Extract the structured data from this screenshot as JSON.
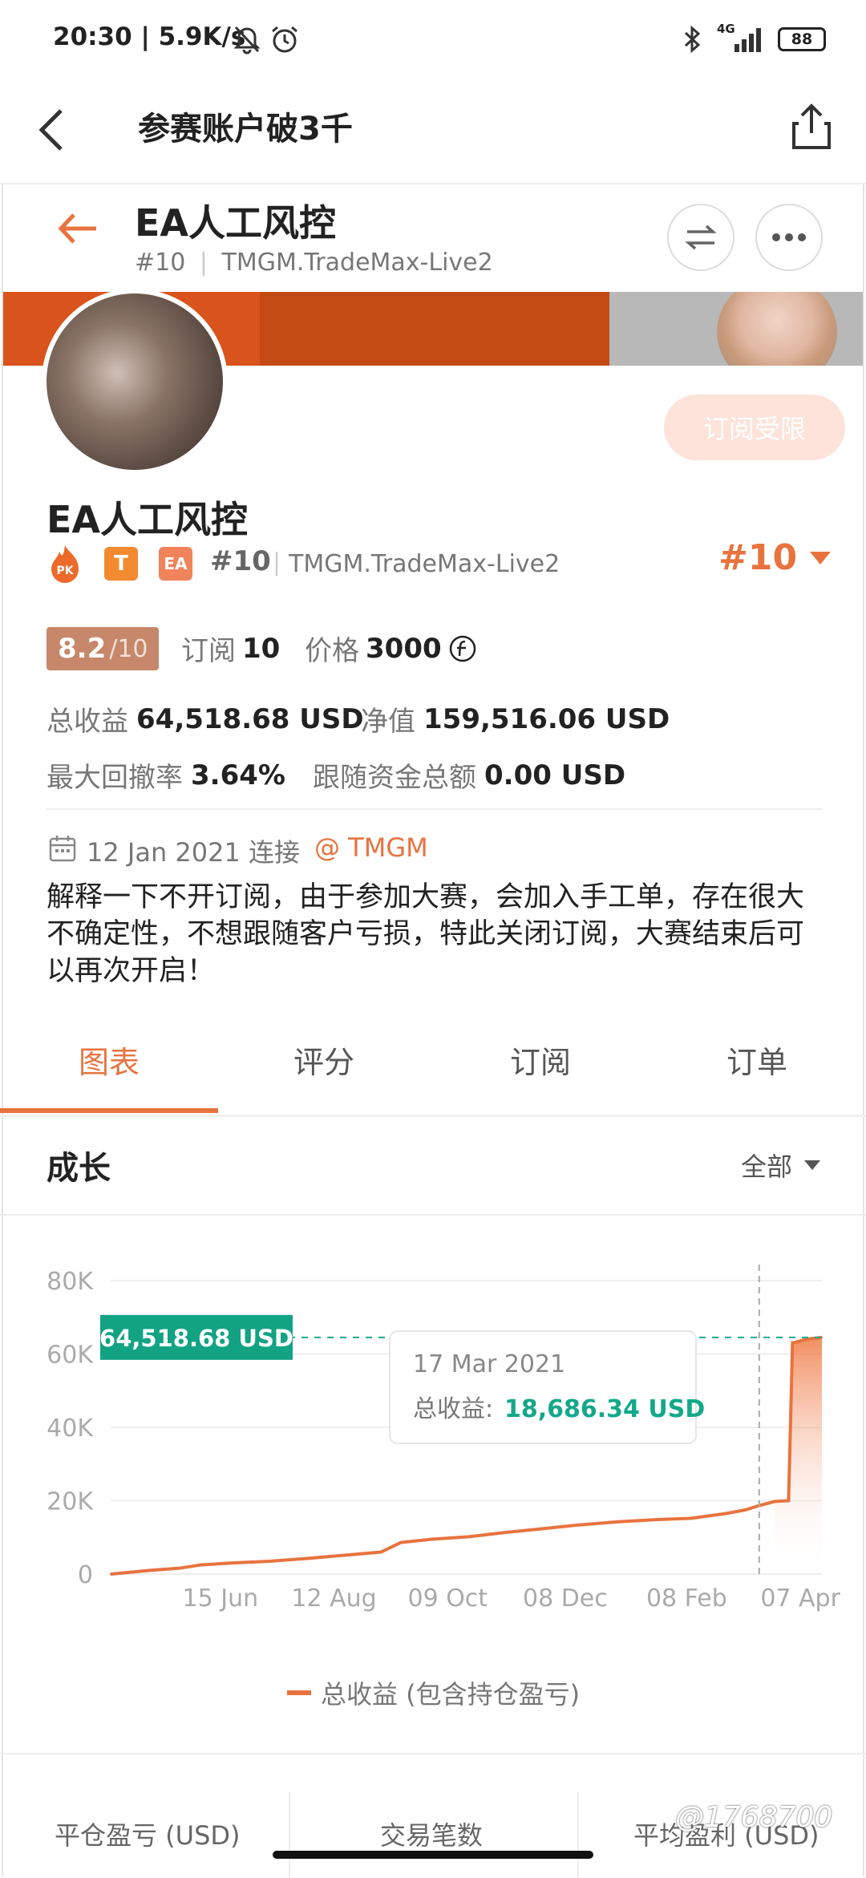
{
  "status_bar": {
    "time": "20:30 | 5.9K/s",
    "battery": "88",
    "network": "4G"
  },
  "navbar": {
    "title": "参赛账户破3千"
  },
  "profile_header": {
    "name": "EA人工风控",
    "rank": "#10",
    "server": "TMGM.TradeMax-Live2"
  },
  "profile": {
    "subscribe_button": "订阅受限",
    "name": "EA人工风控",
    "badges": [
      "T",
      "EA"
    ],
    "rank": "#10",
    "server": "TMGM.TradeMax-Live2",
    "rank_big": "#10",
    "score": "8.2",
    "score_max": "/10",
    "subscriptions_label": "订阅",
    "subscriptions": "10",
    "price_label": "价格",
    "price": "3000",
    "total_profit_label": "总收益",
    "total_profit": "64,518.68 USD",
    "net_value_label": "净值",
    "net_value": "159,516.06 USD",
    "max_drawdown_label": "最大回撤率",
    "max_drawdown": "3.64%",
    "follow_funds_label": "跟随资金总额",
    "follow_funds": "0.00 USD",
    "connected_date": "12 Jan 2021 连接",
    "broker_link": "@ TMGM",
    "description": "解释一下不开订阅，由于参加大赛，会加入手工单，存在很大不确定性，不想跟随客户亏损，特此关闭订阅，大赛结束后可以再次开启！"
  },
  "tabs": [
    {
      "label": "图表",
      "active": true
    },
    {
      "label": "评分",
      "active": false
    },
    {
      "label": "订阅",
      "active": false
    },
    {
      "label": "订单",
      "active": false
    }
  ],
  "growth": {
    "title": "成长",
    "filter": "全部"
  },
  "chart_data": {
    "type": "area",
    "ylim": [
      0,
      80000
    ],
    "yticks": [
      "80K",
      "60K",
      "40K",
      "20K",
      "0"
    ],
    "xticks": [
      "15 Jun",
      "12 Aug",
      "09 Oct",
      "08 Dec",
      "08 Feb",
      "07 Apr"
    ],
    "series": [
      {
        "name": "总收益 (包含持仓盈亏)",
        "color": "#e8733f",
        "x": [
          "2020-04-20",
          "2020-05-10",
          "2020-05-25",
          "2020-06-05",
          "2020-06-20",
          "2020-07-10",
          "2020-07-28",
          "2020-08-10",
          "2020-08-25",
          "2020-09-05",
          "2020-09-15",
          "2020-10-01",
          "2020-10-20",
          "2020-11-05",
          "2020-11-25",
          "2020-12-15",
          "2021-01-05",
          "2021-01-25",
          "2021-02-10",
          "2021-02-28",
          "2021-03-10",
          "2021-03-17",
          "2021-03-25",
          "2021-04-01",
          "2021-04-03",
          "2021-04-10",
          "2021-04-18"
        ],
        "values": [
          0,
          1000,
          1600,
          2500,
          3000,
          3500,
          4200,
          4800,
          5500,
          6000,
          8600,
          9500,
          10200,
          11200,
          12300,
          13400,
          14300,
          14900,
          15200,
          16500,
          17500,
          18686.34,
          19800,
          20000,
          63000,
          64000,
          64518.68
        ]
      }
    ],
    "current_value_label": "64,518.68 USD",
    "tooltip": {
      "date": "17 Mar 2021",
      "label": "总收益:",
      "value": "18,686.34 USD"
    },
    "legend_position": "bottom"
  },
  "stats": [
    {
      "label": "平仓盈亏 (USD)"
    },
    {
      "label": "交易笔数"
    },
    {
      "label": "平均盈利 (USD)"
    }
  ],
  "watermark": "@1768700"
}
